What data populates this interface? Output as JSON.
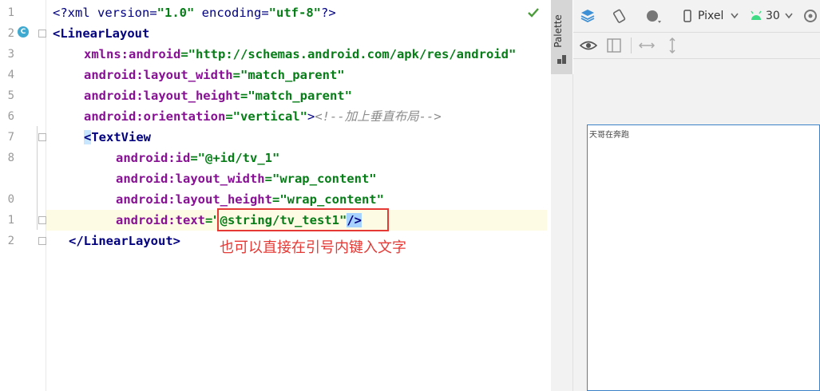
{
  "gutter": {
    "line_numbers": [
      "1",
      "2",
      "3",
      "4",
      "5",
      "6",
      "7",
      "8",
      "0",
      "1",
      "2"
    ],
    "class_badge": "C"
  },
  "code": {
    "line1": {
      "a": "<?xml version=",
      "b": "\"1.0\"",
      "c": " encoding=",
      "d": "\"utf-8\"",
      "e": "?>"
    },
    "line2": {
      "a": "<LinearLayout"
    },
    "line3": {
      "attr": "xmlns:android",
      "eq": "=",
      "val": "\"http://schemas.android.com/apk/res/android\""
    },
    "line4": {
      "attr": "android:layout_width",
      "eq": "=",
      "val": "\"match_parent\""
    },
    "line5": {
      "attr": "android:layout_height",
      "eq": "=",
      "val": "\"match_parent\""
    },
    "line6": {
      "attr": "android:orientation",
      "eq": "=",
      "val": "\"vertical\"",
      "close": ">",
      "comment": "<!--加上垂直布局-->"
    },
    "line7": {
      "lt": "<",
      "tag": "TextView"
    },
    "line8": {
      "attr": "android:id",
      "eq": "=",
      "val": "\"@+id/tv_1\""
    },
    "line9": {
      "attr": "android:layout_width",
      "eq": "=",
      "val": "\"wrap_content\""
    },
    "line10": {
      "attr": "android:layout_height",
      "eq": "=",
      "val": "\"wrap_content\""
    },
    "line11": {
      "attr": "android:text",
      "eq": "=",
      "val": "\"@string/tv_test1\"",
      "close": "/>"
    },
    "line12": {
      "a": "</LinearLayout>"
    }
  },
  "annotation": {
    "text": "也可以直接在引号内键入文字",
    "color": "#e53935"
  },
  "palette": {
    "label": "Palette"
  },
  "design_toolbar": {
    "device_label": "Pixel",
    "api_label": "30"
  },
  "preview": {
    "textview_text": "天哥在奔跑"
  },
  "colors": {
    "attr": "#871094",
    "string": "#067d17",
    "tag": "#000080",
    "comment": "#8c8c8c",
    "current_line": "#fdfbe4",
    "selection": "#a6d2ff"
  }
}
